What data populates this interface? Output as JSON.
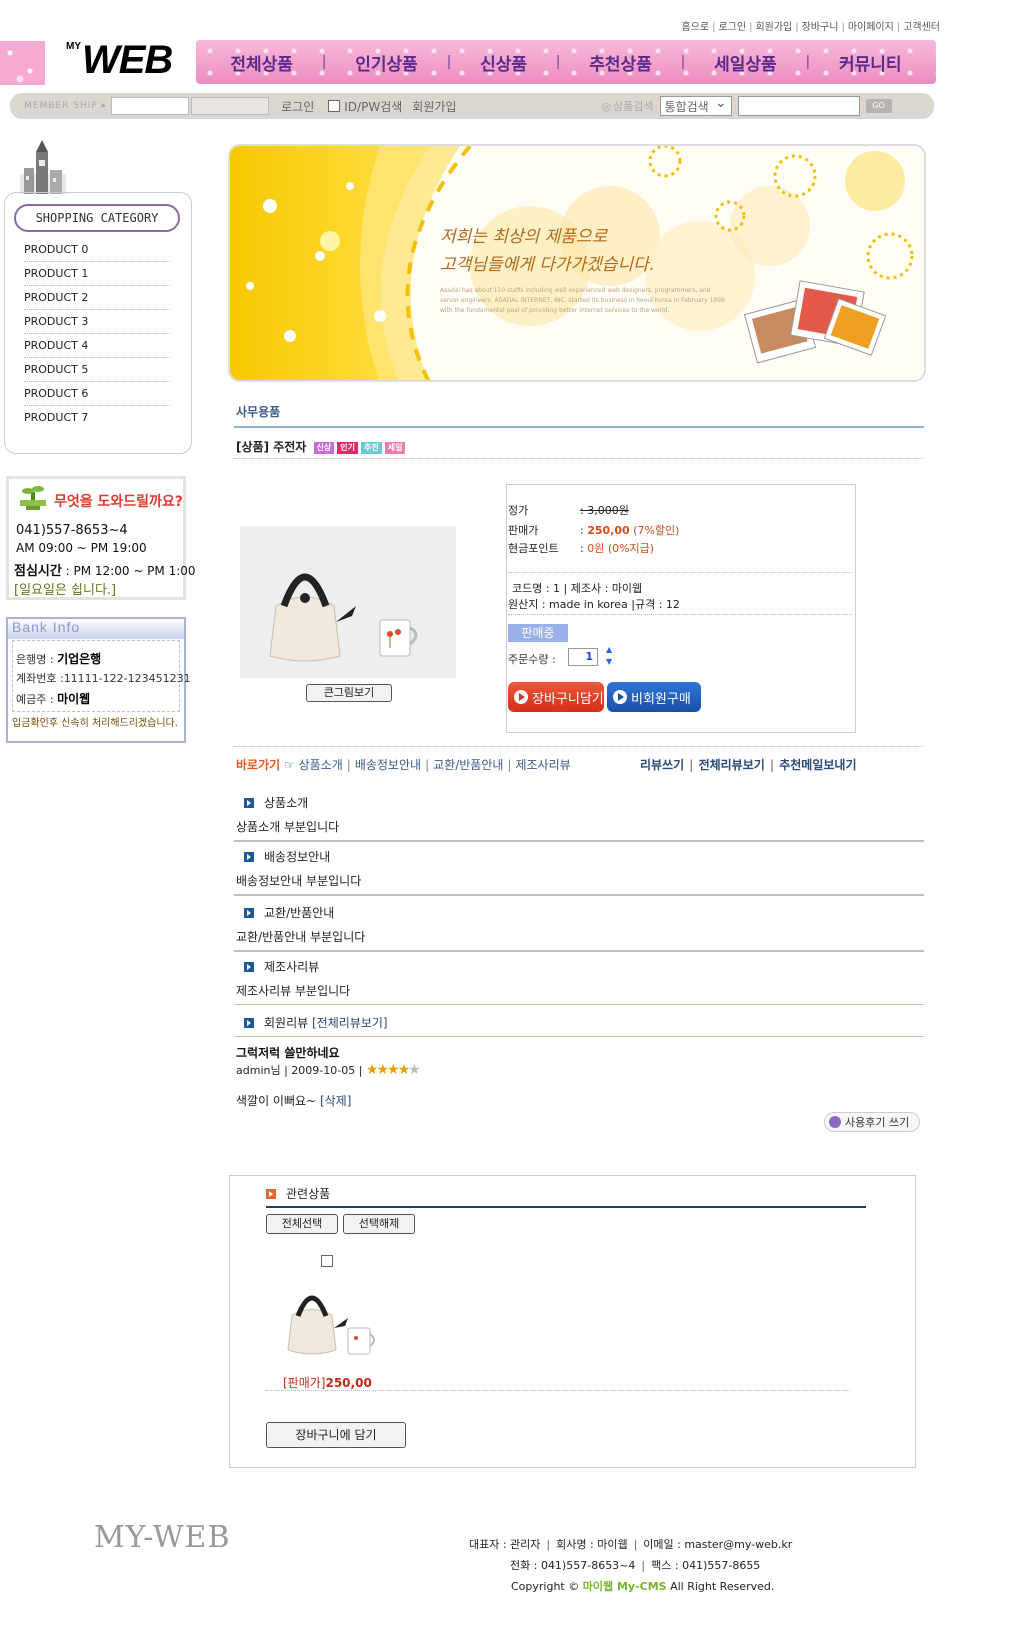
{
  "top_links": [
    "홈으로",
    "로그인",
    "회원가입",
    "장바구니",
    "마이페이지",
    "고객센터"
  ],
  "logo": {
    "my": "MY",
    "web": "WEB"
  },
  "nav": [
    "전체상품",
    "인기상품",
    "신상품",
    "추천상품",
    "세일상품",
    "커뮤니티"
  ],
  "member_bar": {
    "label": "MEMBER SHIP ▸",
    "login": "로그인",
    "idpw": "ID/PW검색",
    "join": "회원가입",
    "search_label": "상품검색",
    "search_option": "통합검색",
    "go": "GO"
  },
  "category": {
    "title": "SHOPPING CATEGORY",
    "items": [
      "PRODUCT 0",
      "PRODUCT 1",
      "PRODUCT 2",
      "PRODUCT 3",
      "PRODUCT 4",
      "PRODUCT 5",
      "PRODUCT 6",
      "PRODUCT 7"
    ]
  },
  "help": {
    "title": "무엇을 도와드릴까요?",
    "phone": "041)557-8653~4",
    "hours": "AM 09:00 ~ PM 19:00",
    "lunch_label": "점심시간",
    "lunch": " : PM 12:00 ~ PM 1:00",
    "sunday": "[일요일은 쉽니다.]"
  },
  "bank": {
    "head": "Bank Info",
    "bank_label": "은행명 :",
    "bank_value": "기업은행",
    "account_label": "계좌번호 :",
    "account_value": "11111-122-123451231",
    "holder_label": "예금주 :",
    "holder_value": "마이웹",
    "note": "입금확인후 신속히 처리해드리겠습니다."
  },
  "banner": {
    "line1": "저희는 최상의 제품으로",
    "line2": "고객님들에게 다가가겠습니다.",
    "small": "Asadal has about 150 staffs including well experienced web designers, programmers, and server engineers. ASADAL INTERNET, INC. started its business in Seoul Korea in February 1998 with the fundamental goal of providing better internet services to the world."
  },
  "section_title": "사무용품",
  "product": {
    "title": "[상품] 주전자",
    "tags": [
      {
        "label": "신상",
        "color": "#c86ad8"
      },
      {
        "label": "인기",
        "color": "#e02a6a"
      },
      {
        "label": "추천",
        "color": "#6ac8d8"
      },
      {
        "label": "세일",
        "color": "#f07aa8"
      }
    ],
    "big_image_btn": "큰그림보기",
    "list_price_label": "정가",
    "list_price": ": 3,000원",
    "price_label": "판매가",
    "price_colon": ": ",
    "price": "250,00",
    "discount": "(7%할인)",
    "point_label": "현금포인트",
    "point_colon": ": ",
    "point": "0원 (0%지급)",
    "code_line": "코드명 : 1 | 제조사 : 마이웹",
    "origin_line": "원산지 : made in korea |규격 : 12",
    "status": "판매중",
    "qty_label": "주문수량 :",
    "qty": "1",
    "cart_btn": "장바구니담기",
    "guest_btn": "비회원구매"
  },
  "jump": {
    "title": "바로가기",
    "icon": "☞",
    "links": [
      "상품소개",
      "배송정보안내",
      "교환/반품안내",
      "제조사리뷰"
    ],
    "right": [
      "리뷰쓰기",
      "전체리뷰보기",
      "추천메일보내기"
    ]
  },
  "sections": [
    {
      "head": "상품소개",
      "body": "상품소개 부분입니다"
    },
    {
      "head": "배송정보안내",
      "body": "배송정보안내 부분입니다"
    },
    {
      "head": "교환/반품안내",
      "body": "교환/반품안내 부분입니다"
    },
    {
      "head": "제조사리뷰",
      "body": "제조사리뷰 부분입니다"
    }
  ],
  "reviews": {
    "head": "회원리뷰",
    "all_link": "[전체리뷰보기]",
    "title": "그럭저럭 쓸만하네요",
    "meta": "admin님 | 2009-10-05 |",
    "rating": 4,
    "body": "색깔이 이뻐요~",
    "delete": "[삭제]",
    "write_btn": "사용후기 쓰기"
  },
  "related": {
    "title": "관련상품",
    "select_all": "전체선택",
    "deselect": "선택해제",
    "price_label": "[판매가]",
    "price": "250,00",
    "cart_btn": "장바구니에 담기"
  },
  "footer": {
    "logo": "MY-WEB",
    "line1": [
      "대표자 : 관리자",
      "회사명 : 마이웹",
      "이메일 : master@my-web.kr"
    ],
    "line2": [
      "전화 : 041)557-8653~4",
      "팩스 : 041)557-8655"
    ],
    "copyright_pre": "Copyright ©",
    "brand": "마이웹  My-CMS",
    "copyright_post": "All Right Reserved."
  }
}
